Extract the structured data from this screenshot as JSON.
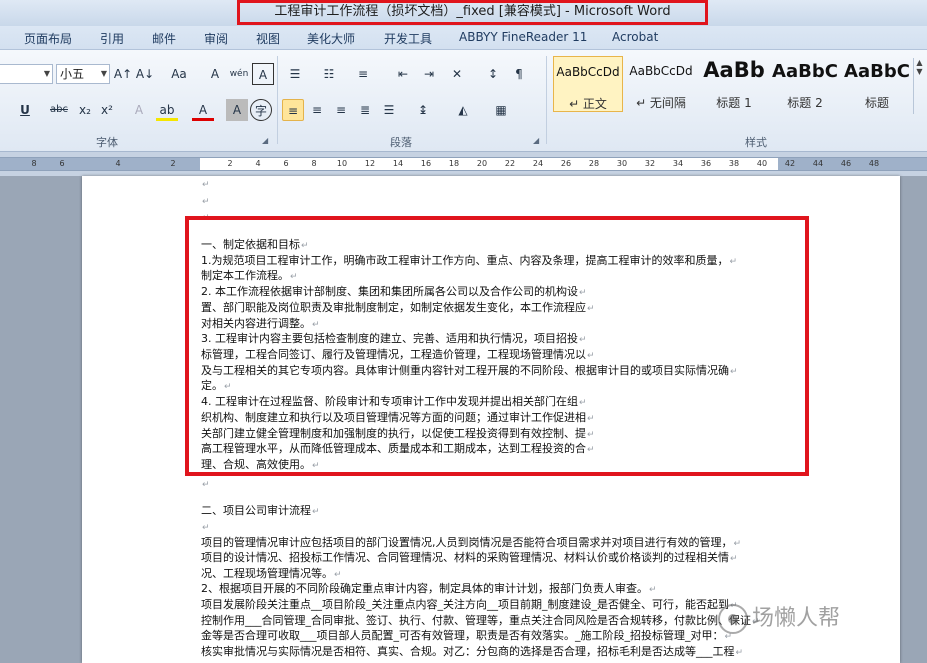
{
  "window": {
    "title": "工程审计工作流程（损坏文档）_fixed [兼容模式] - Microsoft Word"
  },
  "tabs": [
    "页面布局",
    "引用",
    "邮件",
    "审阅",
    "视图",
    "美化大师",
    "开发工具",
    "ABBYY FineReader 11",
    "Acrobat"
  ],
  "ribbon": {
    "font_size_value": "小五",
    "groups": {
      "font": "字体",
      "paragraph": "段落",
      "styles": "样式"
    },
    "styles": [
      {
        "preview": "AaBbCcDd",
        "name": "↵ 正文",
        "selected": true
      },
      {
        "preview": "AaBbCcDd",
        "name": "↵ 无间隔",
        "selected": false
      },
      {
        "preview": "AaBb",
        "name": "标题 1",
        "selected": false
      },
      {
        "preview": "AaBbC",
        "name": "标题 2",
        "selected": false
      },
      {
        "preview": "AaBbC",
        "name": "标题",
        "selected": false
      }
    ],
    "buttons": {
      "grow_font": "A↑",
      "shrink_font": "A↓",
      "change_case": "Aa",
      "clear_format": "A",
      "phonetic": "wén",
      "char_border": "A",
      "underline": "U",
      "strike": "abc",
      "subscript": "x₂",
      "superscript": "x²",
      "text_effect": "A",
      "highlight": "ab",
      "font_color": "A",
      "char_shading": "A",
      "enclose": "字"
    }
  },
  "ruler": {
    "ticks": [
      "8",
      "6",
      "4",
      "2",
      "2",
      "4",
      "6",
      "8",
      "10",
      "12",
      "14",
      "16",
      "18",
      "20",
      "22",
      "24",
      "26",
      "28",
      "30",
      "32",
      "34",
      "36",
      "38",
      "40",
      "42",
      "44",
      "46",
      "48"
    ]
  },
  "document": {
    "lines": [
      "一、制定依据和目标",
      "1.为规范项目工程审计工作，明确市政工程审计工作方向、重点、内容及条理，提高工程审计的效率和质量，",
      "制定本工作流程。",
      "2. 本工作流程依据审计部制度、集团和集团所属各公司以及合作公司的机构设",
      "置、部门职能及岗位职责及审批制度制定，如制定依据发生变化，本工作流程应",
      "对相关内容进行调整。",
      "3.  工程审计内容主要包括检查制度的建立、完善、适用和执行情况，项目招投",
      "标管理，工程合同签订、履行及管理情况，工程造价管理，工程现场管理情况以",
      "及与工程相关的其它专项内容。具体审计侧重内容针对工程开展的不同阶段、根据审计目的或项目实际情况确",
      "定。",
      "4. 工程审计在过程监督、阶段审计和专项审计工作中发现并提出相关部门在组",
      "织机构、制度建立和执行以及项目管理情况等方面的问题；通过审计工作促进相",
      "关部门建立健全管理制度和加强制度的执行，以促使工程投资得到有效控制、提",
      "高工程管理水平，从而降低管理成本、质量成本和工期成本，达到工程投资的合",
      "理、合规、高效使用。",
      "二、项目公司审计流程",
      "项目的管理情况审计应包括项目的部门设置情况,人员到岗情况是否能符合项目需求并对项目进行有效的管理，",
      "项目的设计情况、招投标工作情况、合同管理情况、材料的采购管理情况、材料认价或价格谈判的过程相关情",
      "况、工程现场管理情况等。",
      "2、根据项目开展的不同阶段确定重点审计内容，制定具体的审计计划，报部门负责人审查。",
      "项目发展阶段关注重点__项目阶段_关注重点内容_关注方向__项目前期_制度建设_是否健全、可行，能否起到",
      "控制作用___合同管理_合同审批、签订、执行、付款、管理等，重点关注合同风险是否合规转移，付款比例、保证",
      "金等是否合理可收取___项目部人员配置_可否有效管理，职责是否有效落实。_施工阶段_招投标管理_对甲：",
      "核实审批情况与实际情况是否相符、真实、合规。对乙：分包商的选择是否合理，招标毛利是否达成等___工程"
    ]
  },
  "watermark": {
    "text": "场懒人帮"
  }
}
